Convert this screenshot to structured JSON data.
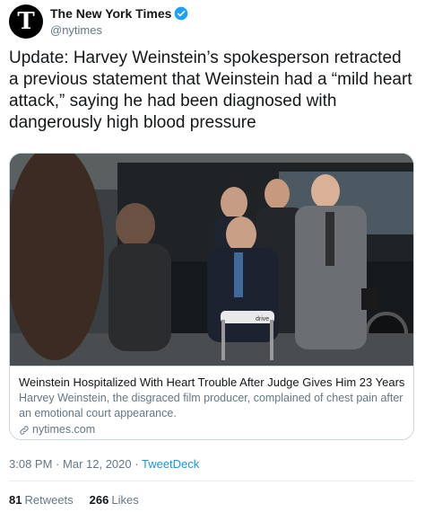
{
  "author": {
    "name": "The New York Times",
    "handle": "@nytimes",
    "avatar_glyph": "T",
    "verified": true
  },
  "tweet_text": "Update: Harvey Weinstein’s spokesperson retracted a previous statement that Weinstein had a “mild heart attack,” saying he had been diagnosed with dangerously high blood pressure",
  "card": {
    "title": "Weinstein Hospitalized With Heart Trouble After Judge Gives Him 23 Years",
    "description": "Harvey Weinstein, the disgraced film producer, complained of chest pain after an emotional court appearance.",
    "domain": "nytimes.com",
    "walker_label": "drive"
  },
  "meta": {
    "time": "3:08 PM",
    "separator1": "·",
    "date": "Mar 12, 2020",
    "separator2": "·",
    "source": "TweetDeck"
  },
  "stats": {
    "retweets_count": "81",
    "retweets_label": "Retweets",
    "likes_count": "266",
    "likes_label": "Likes"
  },
  "colors": {
    "link_blue": "#1b95e0",
    "secondary_text": "#657786",
    "verified_blue": "#1da1f2"
  }
}
